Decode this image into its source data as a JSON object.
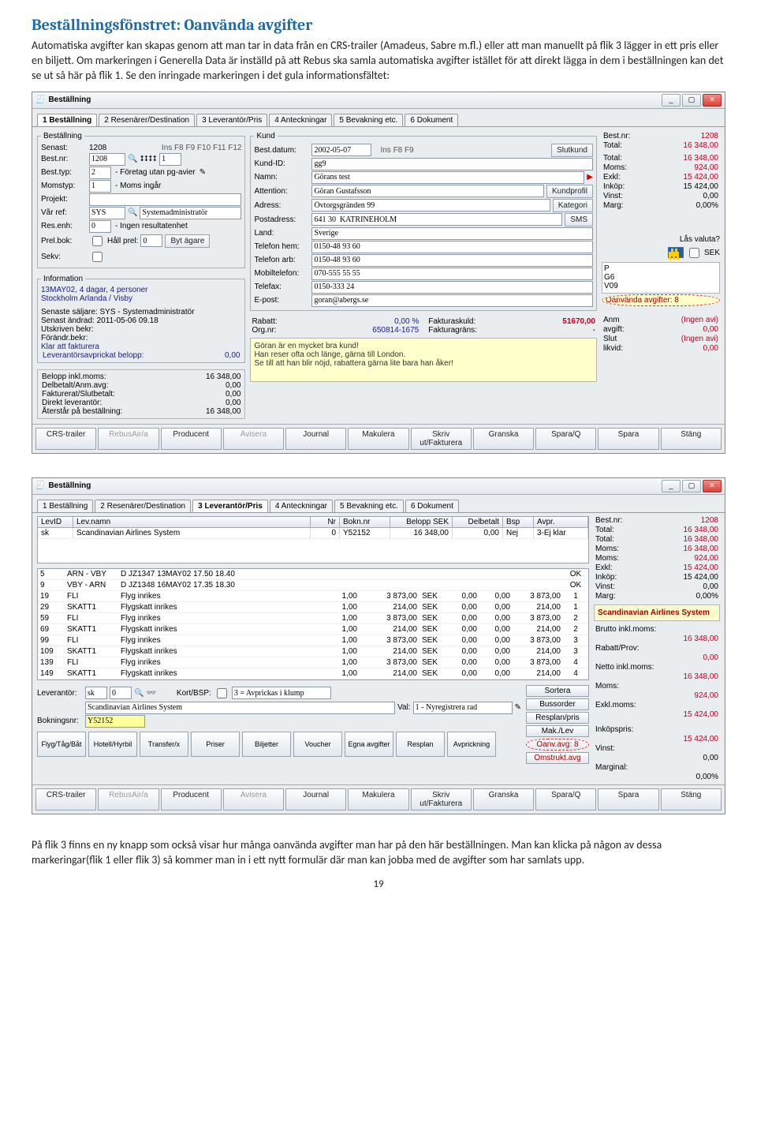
{
  "heading": "Beställningsfönstret: Oanvända avgifter",
  "para1": "Automatiska avgifter kan skapas genom att man tar in data från en CRS-trailer (Amadeus, Sabre m.fl.) eller att man manuellt på flik 3 lägger in ett pris eller en biljett. Om markeringen i Generella Data är inställd på att Rebus ska samla automatiska avgifter istället för att direkt lägga in dem i beställningen kan det se ut så här på flik 1. Se den inringade markeringen i det gula informationsfältet:",
  "para2": "På flik 3 finns en ny knapp som också visar hur många oanvända avgifter man har på den här beställningen. Man kan klicka på någon av dessa markeringar(flik 1 eller flik 3) så kommer man in i ett nytt formulär där man kan jobba med de avgifter som har samlats upp.",
  "page_number": "19",
  "win": {
    "title": "Beställning",
    "tabs": [
      "1 Beställning",
      "2 Resenärer/Destination",
      "3 Leverantör/Pris",
      "4 Anteckningar",
      "5 Bevakning etc.",
      "6 Dokument"
    ]
  },
  "best": {
    "legend": "Beställning",
    "senast_label": "Senast:",
    "senast": "1208",
    "bestnr_label": "Best.nr:",
    "bestnr": "1208",
    "fkeys": "Ins    F8    F9    F10    F11    F12",
    "sort_val": "1",
    "besttyp_label": "Best.typ:",
    "besttyp": "2",
    "besttyp_txt": "- Företag utan pg-avier",
    "momstyp_label": "Momstyp:",
    "momstyp": "1",
    "momstyp_txt": "- Moms ingår",
    "projekt_label": "Projekt:",
    "varref_label": "Vår ref:",
    "varref": "SYS",
    "varref_txt": "Systemadministratör",
    "resenh_label": "Res.enh:",
    "resenh": "0",
    "resenh_txt": "- Ingen resultatenhet",
    "prelbok_label": "Prel.bok:",
    "hallprel_label": "Håll prel:",
    "hallprel": "0",
    "bytagare_btn": "Byt ägare",
    "sekv_label": "Sekv:"
  },
  "kund": {
    "legend": "Kund",
    "bestdatum_label": "Best.datum:",
    "bestdatum": "2002-05-07",
    "fkeys": "Ins    F8    F9",
    "slutkund_btn": "Slutkund",
    "kundid_label": "Kund-ID:",
    "kundid": "gg9",
    "namn_label": "Namn:",
    "namn": "Görans test",
    "attention_label": "Attention:",
    "attention": "Göran Gustafsson",
    "adress_label": "Adress:",
    "adress": "Övtorgsgränden 99",
    "postadress_label": "Postadress:",
    "postadress": "641 30  KATRINEHOLM",
    "land_label": "Land:",
    "land": "Sverige",
    "telhem_label": "Telefon hem:",
    "telhem": "0150-48 93 60",
    "telarb_label": "Telefon arb:",
    "telarb": "0150-48 93 60",
    "mobil_label": "Mobiltelefon:",
    "mobil": "070-555 55 55",
    "telefax_label": "Telefax:",
    "telefax": "0150-333 24",
    "epost_label": "E-post:",
    "epost": "goran@abergs.se",
    "kundprofil_btn": "Kundprofil",
    "kategori_btn": "Kategori",
    "sms_btn": "SMS"
  },
  "info": {
    "legend": "Information",
    "line1": "13MAY02, 4 dagar, 4 personer",
    "line2": "Stockholm Arlanda / Visby",
    "line3": "Senaste säljare: SYS - Systemadministratör",
    "line4": "Senast ändrad: 2011-05-06 09.18",
    "line5": "Utskriven bekr:",
    "line6": "Förändr.bekr:",
    "line7": "Klar att fakturera",
    "line8": "Leverantörsavprickat belopp:",
    "line8v": "0,00"
  },
  "sums": {
    "l1": "Belopp inkl.moms:",
    "v1": "16 348,00",
    "l2": "Delbetalt/Anm.avg:",
    "v2": "0,00",
    "l3": "Fakturerat/Slutbetalt:",
    "v3": "0,00",
    "l4": "Direkt leverantör:",
    "v4": "0,00",
    "l5": "Återstår på beställning:",
    "v5": "16 348,00"
  },
  "rab": {
    "rabatt_label": "Rabatt:",
    "rabatt": "0,00 %",
    "orgnr_label": "Org.nr:",
    "orgnr": "650814-1675",
    "fakturaskuld_label": "Fakturaskuld:",
    "fakturaskuld": "51670,00",
    "fakturagrans_label": "Fakturagräns:",
    "fakturagrans": "-"
  },
  "yellow": {
    "l1": "Göran är en mycket bra kund!",
    "l2": "Han reser ofta och länge, gärna till London.",
    "l3": "Se till att han blir nöjd, rabattera gärna lite bara han åker!"
  },
  "right1": {
    "bestnr_lbl": "Best.nr:",
    "bestnr": "1208",
    "total_lbl": "Total:",
    "total": "16 348,00",
    "total2_lbl": "Total:",
    "total2": "16 348,00",
    "moms_lbl": "Moms:",
    "moms": "924,00",
    "exkl_lbl": "Exkl:",
    "exkl": "15 424,00",
    "inkop_lbl": "Inköp:",
    "inkop": "15 424,00",
    "vinst_lbl": "Vinst:",
    "vinst": "0,00",
    "marg_lbl": "Marg:",
    "marg": "0,00%",
    "las_valuta": "Lås valuta?",
    "sek": "SEK",
    "codes": [
      "P",
      "G6",
      "V09"
    ],
    "oanv": "Oanvända avgifter: 8",
    "anm_lbl": "Anm",
    "anm": "",
    "avgift_lbl": "avgift:",
    "avgift": "(Ingen avi)",
    "slut_lbl": "Slut",
    "slut": "0,00",
    "likvid_lbl": "likvid:",
    "likvid": "(Ingen avi)",
    "likvid_v": "0,00"
  },
  "btns1": [
    "CRS-trailer",
    "RebusAir/a",
    "Producent",
    "Avisera",
    "Journal",
    "Makulera",
    "Skriv ut/Fakturera",
    "Granska",
    "Spara/Q",
    "Spara",
    "Stäng"
  ],
  "table1": {
    "headers": [
      "LevID",
      "Lev.namn",
      "Nr",
      "Bokn.nr",
      "Belopp SEK",
      "Delbetalt",
      "Bsp",
      "Avpr."
    ],
    "row": {
      "lev": "sk",
      "levn": "Scandinavian Airlines System",
      "nr": "0",
      "bok": "Y52152",
      "bel": "16 348,00",
      "del": "0,00",
      "bsp": "Nej",
      "avp": "3-Ej klar"
    }
  },
  "right2": {
    "bestnr_lbl": "Best.nr:",
    "bestnr": "1208",
    "total_lbl": "Total:",
    "total": "16 348,00",
    "total2_lbl": "Total:",
    "total2": "16 348,00",
    "moms_lbl": "Moms:",
    "moms": "16 348,00",
    "moms2_lbl": "Moms:",
    "moms2": "924,00",
    "exkl_lbl": "Exkl:",
    "exkl": "15 424,00",
    "inkop_lbl": "Inköp:",
    "inkop": "15 424,00",
    "vinst_lbl": "Vinst:",
    "vinst": "0,00",
    "marg_lbl": "Marg:",
    "marg": "0,00%",
    "sas": "Scandinavian Airlines System",
    "brutto_lbl": "Brutto inkl.moms:",
    "brutto": "16 348,00",
    "rabatt_lbl": "Rabatt/Prov:",
    "rabatt": "0,00",
    "netto_lbl": "Netto inkl.moms:",
    "netto": "16 348,00",
    "moms3_lbl": "Moms:",
    "moms3": "924,00",
    "exkl2_lbl": "Exkl.moms:",
    "exkl2": "15 424,00",
    "inkops_lbl": "Inköpspris:",
    "inkops": "15 424,00",
    "vinst2_lbl": "Vinst:",
    "vinst2": "0,00",
    "marg2_lbl": "Marginal:",
    "marg2": "0,00%"
  },
  "detail": {
    "rows": [
      {
        "nr": "5",
        "code": "ARN - VBY",
        "desc": "D JZ1347 13MAY02 17.50 18.40",
        "q": "",
        "amt": "",
        "cur": "",
        "z": "",
        "z2": "",
        "tot": "",
        "ok": "OK"
      },
      {
        "nr": "9",
        "code": "VBY - ARN",
        "desc": "D JZ1348 16MAY02 17.35 18.30",
        "q": "",
        "amt": "",
        "cur": "",
        "z": "",
        "z2": "",
        "tot": "",
        "ok": "OK"
      },
      {
        "nr": "19",
        "code": "FLI",
        "desc": "Flyg inrikes",
        "q": "1,00",
        "amt": "3 873,00",
        "cur": "SEK",
        "z": "0,00",
        "z2": "0,00",
        "tot": "3 873,00",
        "ok": "1"
      },
      {
        "nr": "29",
        "code": "SKATT1",
        "desc": "Flygskatt inrikes",
        "q": "1,00",
        "amt": "214,00",
        "cur": "SEK",
        "z": "0,00",
        "z2": "0,00",
        "tot": "214,00",
        "ok": "1"
      },
      {
        "nr": "59",
        "code": "FLI",
        "desc": "Flyg inrikes",
        "q": "1,00",
        "amt": "3 873,00",
        "cur": "SEK",
        "z": "0,00",
        "z2": "0,00",
        "tot": "3 873,00",
        "ok": "2"
      },
      {
        "nr": "69",
        "code": "SKATT1",
        "desc": "Flygskatt inrikes",
        "q": "1,00",
        "amt": "214,00",
        "cur": "SEK",
        "z": "0,00",
        "z2": "0,00",
        "tot": "214,00",
        "ok": "2"
      },
      {
        "nr": "99",
        "code": "FLI",
        "desc": "Flyg inrikes",
        "q": "1,00",
        "amt": "3 873,00",
        "cur": "SEK",
        "z": "0,00",
        "z2": "0,00",
        "tot": "3 873,00",
        "ok": "3"
      },
      {
        "nr": "109",
        "code": "SKATT1",
        "desc": "Flygskatt inrikes",
        "q": "1,00",
        "amt": "214,00",
        "cur": "SEK",
        "z": "0,00",
        "z2": "0,00",
        "tot": "214,00",
        "ok": "3"
      },
      {
        "nr": "139",
        "code": "FLI",
        "desc": "Flyg inrikes",
        "q": "1,00",
        "amt": "3 873,00",
        "cur": "SEK",
        "z": "0,00",
        "z2": "0,00",
        "tot": "3 873,00",
        "ok": "4"
      },
      {
        "nr": "149",
        "code": "SKATT1",
        "desc": "Flygskatt inrikes",
        "q": "1,00",
        "amt": "214,00",
        "cur": "SEK",
        "z": "0,00",
        "z2": "0,00",
        "tot": "214,00",
        "ok": "4"
      }
    ]
  },
  "levfoot": {
    "lev_lbl": "Leverantör:",
    "lev": "sk",
    "levn": "Scandinavian Airlines System",
    "levnr": "0",
    "kort_lbl": "Kort/BSP:",
    "kort": "3 = Avprickas i klump",
    "val_lbl": "Val:",
    "val": "1 - Nyregistrera rad",
    "bok_lbl": "Bokningsnr:",
    "bok": "Y52152"
  },
  "sidebtns": [
    "Sortera",
    "Bussorder",
    "Resplan/pris",
    "Mak./Lev",
    "Oanv.avg: 8",
    "Omstrukt.avg"
  ],
  "botcats": [
    "Flyg/Tåg/Båt",
    "Hotell/Hyrbil",
    "Transfer/x",
    "Priser",
    "Biljetter",
    "Voucher",
    "Egna avgifter",
    "Resplan",
    "Avprickning"
  ],
  "btns2": [
    "CRS-trailer",
    "RebusAir/a",
    "Producent",
    "Avisera",
    "Journal",
    "Makulera",
    "Skriv ut/Fakturera",
    "Granska",
    "Spara/Q",
    "Spara",
    "Stäng"
  ]
}
